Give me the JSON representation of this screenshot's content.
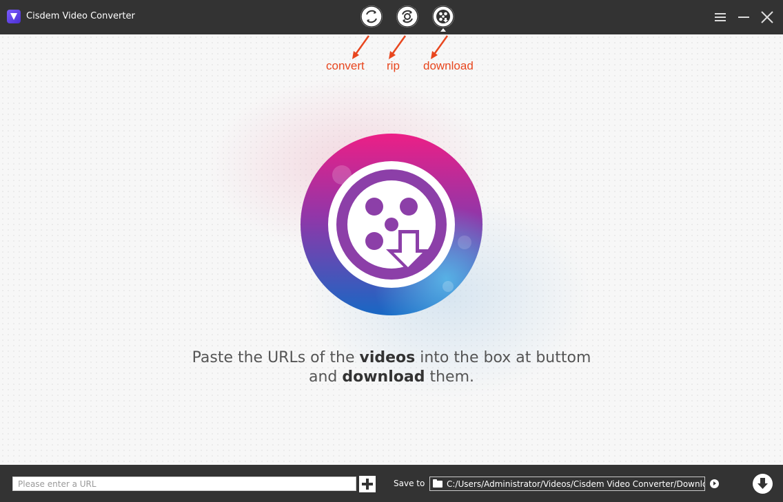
{
  "titlebar": {
    "app_title": "Cisdem Video Converter",
    "logo_icon": "cisdem-v-logo",
    "modes": [
      {
        "name": "convert",
        "icon": "convert-icon"
      },
      {
        "name": "rip",
        "icon": "rip-icon"
      },
      {
        "name": "download",
        "icon": "download-icon",
        "active": true
      }
    ],
    "controls": [
      "menu-icon",
      "minimize-icon",
      "close-icon"
    ]
  },
  "annotations": {
    "convert": "convert",
    "rip": "rip",
    "download": "download",
    "color": "#e8461e"
  },
  "main": {
    "hero_icon": "video-download-icon",
    "message_line1_pre": "Paste the URLs of the ",
    "message_line1_bold": "videos",
    "message_line1_post": " into the box at buttom",
    "message_line2_pre": "and ",
    "message_line2_bold": "download",
    "message_line2_post": " them."
  },
  "bottombar": {
    "url_placeholder": "Please enter a URL",
    "url_value": "",
    "save_to_label": "Save to",
    "save_path": "C:/Users/Administrator/Videos/Cisdem Video Converter/Downlc"
  },
  "colors": {
    "titlebar_bg": "#333333",
    "hero_gradient_top": "#e8218a",
    "hero_gradient_mid": "#8a3db0",
    "hero_gradient_bottom": "#1e62c0",
    "hero_inner": "#8c3fa8"
  }
}
